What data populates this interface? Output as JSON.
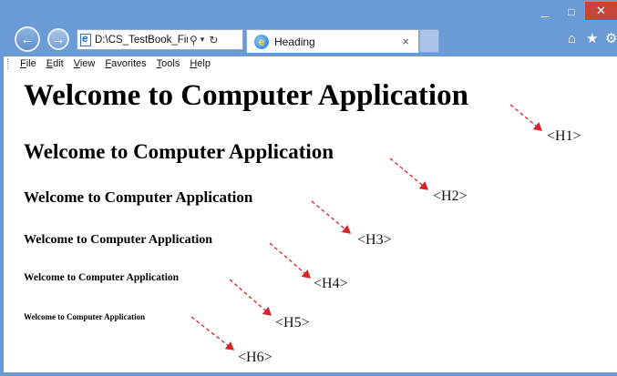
{
  "browser": {
    "address": "D:\\CS_TestBook_Final\\",
    "tab_title": "Heading",
    "tab_close": "×",
    "controls": {
      "minimize": "_",
      "maximize": "□",
      "close": "✕"
    },
    "icons": {
      "back": "back-arrow-icon",
      "forward": "forward-arrow-icon",
      "home": "home-icon",
      "favorites": "star-icon",
      "tools": "gear-icon"
    }
  },
  "menu": {
    "items": [
      "File",
      "Edit",
      "View",
      "Favorites",
      "Tools",
      "Help"
    ]
  },
  "content": {
    "headings": [
      {
        "text": "Welcome to Computer Application",
        "tag": "<H1>"
      },
      {
        "text": "Welcome to Computer Application",
        "tag": "<H2>"
      },
      {
        "text": "Welcome to Computer Application",
        "tag": "<H3>"
      },
      {
        "text": "Welcome to Computer Application",
        "tag": "<H4>"
      },
      {
        "text": "Welcome to Computer Application",
        "tag": "<H5>"
      },
      {
        "text": "Welcome to Computer Application",
        "tag": "<H6>"
      }
    ],
    "arrow_color": "#d8232a"
  }
}
